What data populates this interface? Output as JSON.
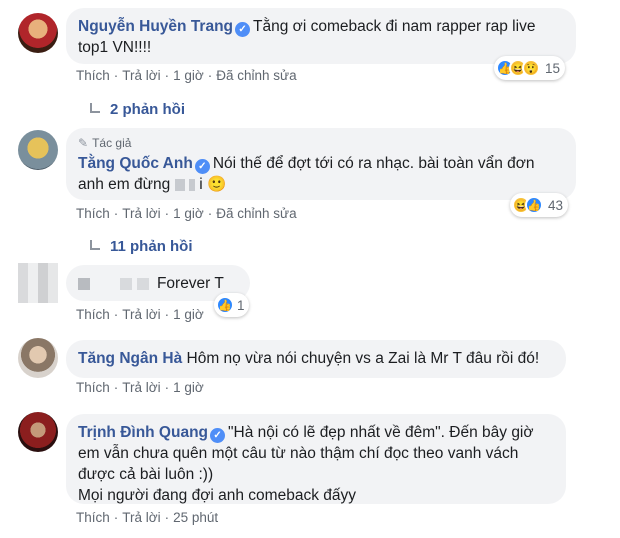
{
  "actions": {
    "like": "Thích",
    "reply": "Trả lời",
    "sep": "·"
  },
  "comments": [
    {
      "name": "Nguyễn Huyền Trang",
      "text": "Tằng ơi comeback đi nam rapper rap live top1 VN!!!!",
      "time": "1 giờ",
      "edited": "Đã chỉnh sửa",
      "reaction_count": "15",
      "replies": "2 phản hồi"
    },
    {
      "author_tag": "Tác giả",
      "name": "Tằng Quốc Anh",
      "text_line1": "Nói thế để đợt tới có ra nhạc. bài toàn vẩn đơn",
      "text_line2_a": "anh em đừng",
      "text_line2_b": "i",
      "emoji": "🙂",
      "time": "1 giờ",
      "edited": "Đã chỉnh sửa",
      "reaction_count": "43",
      "replies": "11 phản hồi"
    },
    {
      "text": "Forever T",
      "time": "1 giờ",
      "reaction_count": "1"
    },
    {
      "name": "Tăng Ngân Hà",
      "text": "Hôm nọ vừa nói chuyện vs a Zai là Mr T đâu rồi đó!",
      "time": "1 giờ"
    },
    {
      "name": "Trịnh Đình Quang",
      "text_line1": "\"Hà nội có lẽ đẹp nhất về đêm\". Đến bây giờ",
      "text_line2": "em vẫn chưa quên một câu từ nào thậm chí đọc theo vanh vách",
      "text_line3": "được cả bài luôn :))",
      "text_line4": "Mọi người đang đợi anh comeback đấyy",
      "time": "25 phút"
    }
  ],
  "colors": {
    "name": "#385898",
    "bubble": "#f2f3f5",
    "meta": "#606770",
    "verified": "#4f8ef7"
  },
  "icons": [
    "verified-icon",
    "like-reaction-icon",
    "haha-reaction-icon",
    "wow-reaction-icon",
    "reply-arrow-icon"
  ]
}
